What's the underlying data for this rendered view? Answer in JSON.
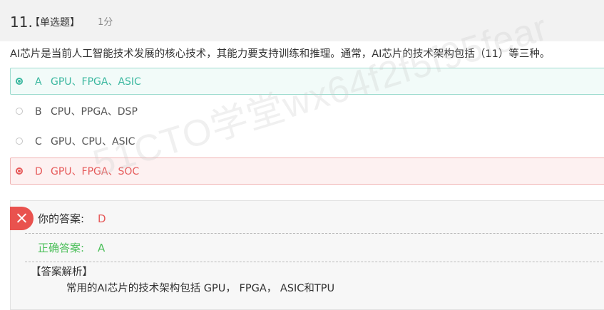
{
  "question": {
    "number": "11.",
    "type": "【单选题】",
    "score": "1分",
    "text": "AI芯片是当前人工智能技术发展的核心技术，其能力要支持训练和推理。通常，AI芯片的技术架构包括（11）等三种。"
  },
  "options": [
    {
      "letter": "A",
      "text": "GPU、FPGA、ASIC",
      "state": "correct"
    },
    {
      "letter": "B",
      "text": "CPU、PPGA、DSP",
      "state": "normal"
    },
    {
      "letter": "C",
      "text": "GPU、CPU、ASIC",
      "state": "normal"
    },
    {
      "letter": "D",
      "text": "GPU、FPGA、SOC",
      "state": "wrong"
    }
  ],
  "answer": {
    "icon": "close-icon",
    "your_label": "你的答案:",
    "your_value": "D",
    "correct_label": "正确答案:",
    "correct_value": "A",
    "analysis_title": "【答案解析】",
    "analysis_text": "常用的AI芯片的技术架构包括 GPU， FPGA， ASIC和TPU"
  },
  "watermark": "51CTO学堂wx64f2f5f95fear",
  "colors": {
    "correct": "#3cb8a0",
    "wrong": "#e65a5a",
    "correct_answer_text": "#4cbf5a",
    "header_bg": "#f2f2f2"
  }
}
